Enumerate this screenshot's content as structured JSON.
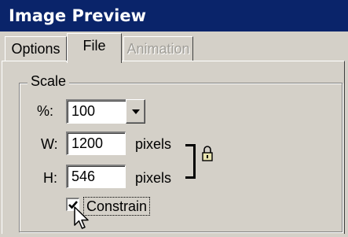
{
  "window": {
    "title": "Image Preview"
  },
  "tabs": [
    {
      "label": "Options",
      "state": "normal"
    },
    {
      "label": "File",
      "state": "active"
    },
    {
      "label": "Animation",
      "state": "disabled"
    }
  ],
  "scale": {
    "group_label": "Scale",
    "percent": {
      "label": "%:",
      "value": "100"
    },
    "width": {
      "label": "W:",
      "value": "1200",
      "unit": "pixels"
    },
    "height": {
      "label": "H:",
      "value": "546",
      "unit": "pixels"
    },
    "constrain": {
      "label": "Constrain",
      "checked": true
    }
  },
  "icons": [
    "chevron-down-icon",
    "lock-icon",
    "checkmark-icon",
    "mouse-pointer-icon"
  ],
  "colors": {
    "titlebar": "#0a246a",
    "face": "#d4d0c8",
    "disabled_text": "#a09e98"
  }
}
